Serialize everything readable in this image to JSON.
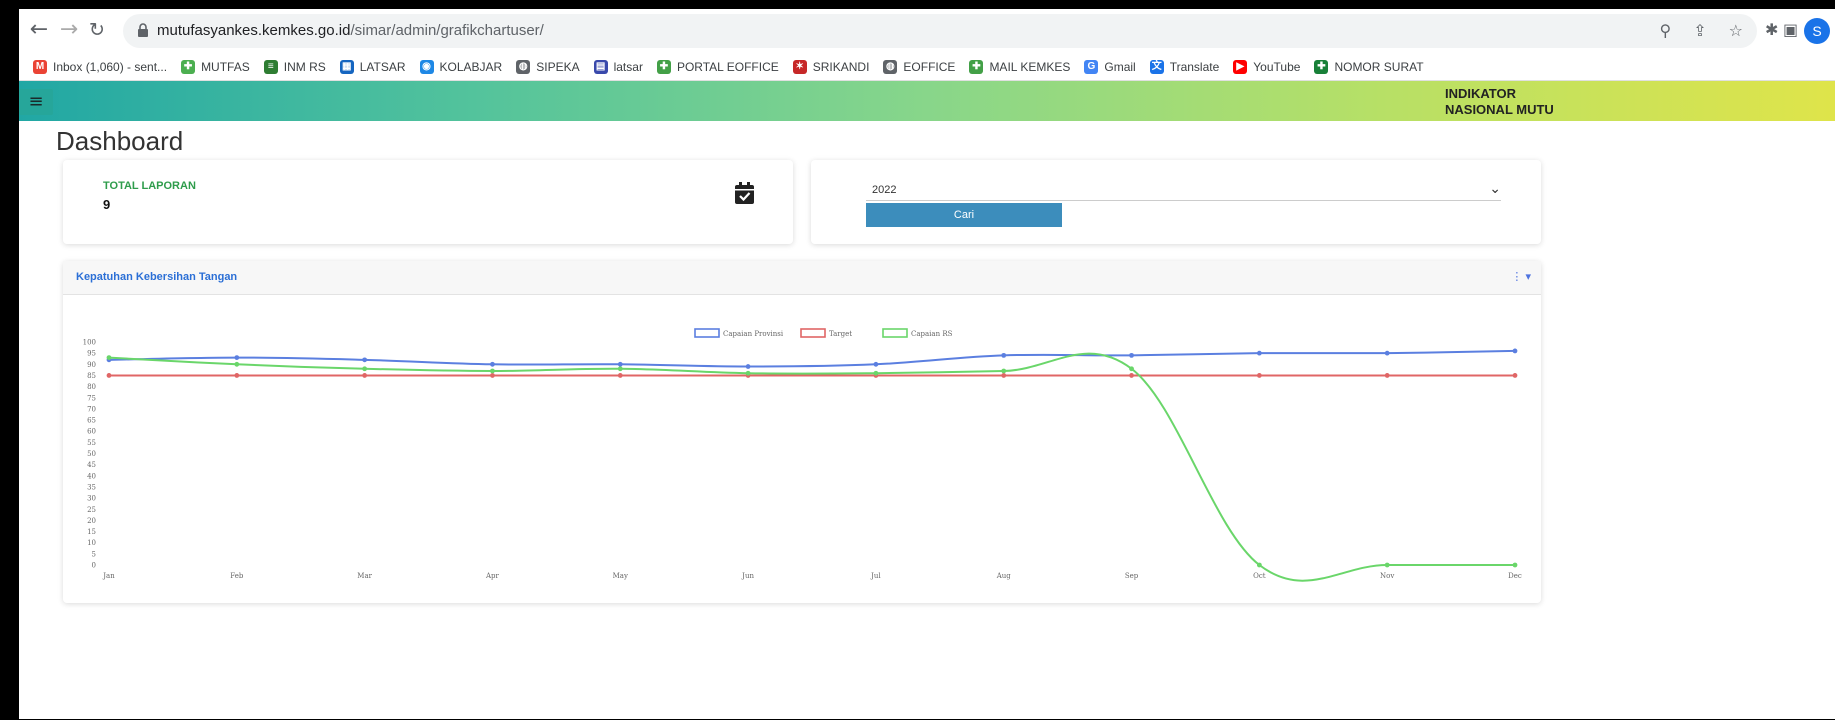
{
  "browser": {
    "url_host": "mutufasyankes.kemkes.go.id",
    "url_path": "/simar/admin/grafikchartuser/",
    "profile_initial": "S"
  },
  "bookmarks": [
    {
      "label": "Inbox (1,060) - sent...",
      "icon": "gmail-icon",
      "color": "#ea4335",
      "glyph": "M"
    },
    {
      "label": "MUTFAS",
      "icon": "kemkes-icon",
      "color": "#4caf50",
      "glyph": "✚"
    },
    {
      "label": "INM RS",
      "icon": "inm-icon",
      "color": "#2e7d32",
      "glyph": "≡"
    },
    {
      "label": "LATSAR",
      "icon": "latsar-icon",
      "color": "#1565c0",
      "glyph": "▦"
    },
    {
      "label": "KOLABJAR",
      "icon": "kolabjar-icon",
      "color": "#1e88e5",
      "glyph": "◉"
    },
    {
      "label": "SIPEKA",
      "icon": "globe-icon",
      "color": "#5f6368",
      "glyph": "◍"
    },
    {
      "label": "latsar",
      "icon": "latsar-square-icon",
      "color": "#3949ab",
      "glyph": "▤"
    },
    {
      "label": "PORTAL EOFFICE",
      "icon": "kemkes-icon",
      "color": "#43a047",
      "glyph": "✚"
    },
    {
      "label": "SRIKANDI",
      "icon": "srikandi-icon",
      "color": "#c62828",
      "glyph": "✶"
    },
    {
      "label": "EOFFICE",
      "icon": "globe-icon",
      "color": "#5f6368",
      "glyph": "◍"
    },
    {
      "label": "MAIL KEMKES",
      "icon": "kemkes-icon",
      "color": "#43a047",
      "glyph": "✚"
    },
    {
      "label": "Gmail",
      "icon": "google-icon",
      "color": "#4285f4",
      "glyph": "G"
    },
    {
      "label": "Translate",
      "icon": "translate-icon",
      "color": "#1a73e8",
      "glyph": "文"
    },
    {
      "label": "YouTube",
      "icon": "youtube-icon",
      "color": "#ff0000",
      "glyph": "▶"
    },
    {
      "label": "NOMOR SURAT",
      "icon": "nomor-surat-icon",
      "color": "#188038",
      "glyph": "✚"
    }
  ],
  "app": {
    "brand": "INDIKATOR NASIONAL MUTU",
    "page_title": "Dashboard",
    "total_label": "TOTAL LAPORAN",
    "total_value": "9",
    "year_selected": "2022",
    "search_button": "Cari",
    "chart_title": "Kepatuhan Kebersihan Tangan"
  },
  "chart_data": {
    "type": "line",
    "title": "",
    "xlabel": "",
    "ylabel": "",
    "categories": [
      "Jan",
      "Feb",
      "Mar",
      "Apr",
      "May",
      "Jun",
      "Jul",
      "Aug",
      "Sep",
      "Oct",
      "Nov",
      "Dec"
    ],
    "ylim": [
      0,
      100
    ],
    "yticks": [
      0,
      5,
      10,
      15,
      20,
      25,
      30,
      35,
      40,
      45,
      50,
      55,
      60,
      65,
      70,
      75,
      80,
      85,
      90,
      95,
      100
    ],
    "legend_position": "top-center",
    "grid": false,
    "series": [
      {
        "name": "Capaian Provinsi",
        "color": "#5b7fe0",
        "values": [
          92,
          93,
          92,
          90,
          90,
          89,
          90,
          94,
          94,
          95,
          95,
          96
        ]
      },
      {
        "name": "Target",
        "color": "#e06666",
        "values": [
          85,
          85,
          85,
          85,
          85,
          85,
          85,
          85,
          85,
          85,
          85,
          85
        ]
      },
      {
        "name": "Capaian RS",
        "color": "#6ad66a",
        "values": [
          93,
          90,
          88,
          87,
          88,
          86,
          86,
          87,
          88,
          0,
          0,
          0
        ]
      }
    ]
  }
}
